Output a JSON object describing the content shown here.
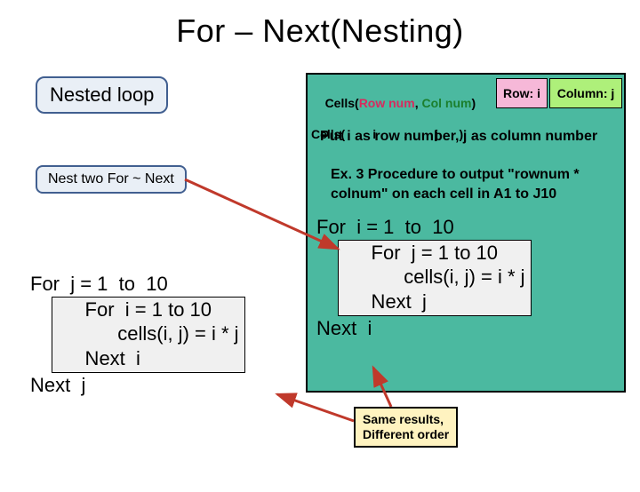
{
  "title": "For – Next(Nesting)",
  "callout_nested": "Nested loop",
  "callout_nest_two": "Nest two For ~ Next",
  "big_box": {
    "cells_line1_prefix": "Cells(",
    "cells_line1_row": "Row num",
    "cells_line1_sep": ", ",
    "cells_line1_col": "Col num",
    "cells_line1_suffix": ")",
    "cells_line2": "Cells(        i        ,        j      )",
    "pink_label": "Row: i",
    "green_label": "Column: j",
    "subhead": "Put i as row number, j as column number",
    "example": "Ex. 3 Procedure to output \"rownum * colnum\" on each cell in A1 to J10"
  },
  "left_code": {
    "l1": "For  j = 1  to  10",
    "l2": "     For  i = 1 to 10",
    "l3": "           cells(i, j) = i * j",
    "l4": "     Next  i",
    "l5": "Next  j"
  },
  "right_code": {
    "l1": "For  i = 1  to  10",
    "l2": "     For  j = 1 to 10",
    "l3": "           cells(i, j) = i * j",
    "l4": "     Next  j",
    "l5": "Next  i"
  },
  "same_box": {
    "l1": "Same results,",
    "l2": "Different order"
  }
}
